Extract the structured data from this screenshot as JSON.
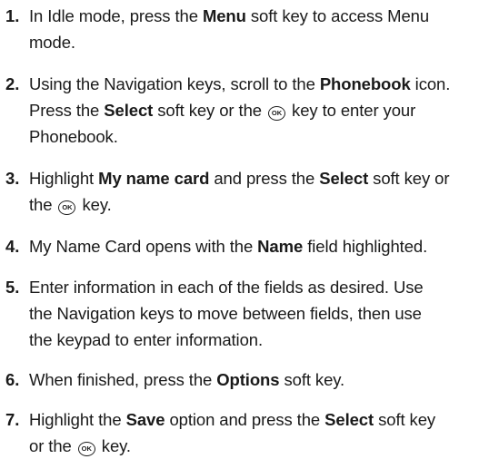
{
  "document": {
    "steps": [
      {
        "number": "1.",
        "parts": [
          {
            "t": "text",
            "v": "In Idle mode, press the "
          },
          {
            "t": "bold",
            "v": "Menu"
          },
          {
            "t": "text",
            "v": " soft key to access Menu"
          },
          {
            "t": "br"
          },
          {
            "t": "text",
            "v": "mode."
          }
        ]
      },
      {
        "number": "2.",
        "parts": [
          {
            "t": "text",
            "v": "Using the Navigation keys, scroll to the "
          },
          {
            "t": "bold",
            "v": "Phonebook"
          },
          {
            "t": "text",
            "v": " icon."
          },
          {
            "t": "br"
          },
          {
            "t": "text",
            "v": "Press the "
          },
          {
            "t": "bold",
            "v": "Select"
          },
          {
            "t": "text",
            "v": " soft key or the "
          },
          {
            "t": "icon",
            "v": "OK"
          },
          {
            "t": "text",
            "v": " key to enter your"
          },
          {
            "t": "br"
          },
          {
            "t": "text",
            "v": "Phonebook."
          }
        ]
      },
      {
        "number": "3.",
        "parts": [
          {
            "t": "text",
            "v": "Highlight "
          },
          {
            "t": "bold",
            "v": "My name card"
          },
          {
            "t": "text",
            "v": " and press the "
          },
          {
            "t": "bold",
            "v": "Select"
          },
          {
            "t": "text",
            "v": " soft key or"
          },
          {
            "t": "br"
          },
          {
            "t": "text",
            "v": "the "
          },
          {
            "t": "icon",
            "v": "OK"
          },
          {
            "t": "text",
            "v": " key."
          }
        ]
      },
      {
        "number": "4.",
        "parts": [
          {
            "t": "text",
            "v": "My Name Card opens with the "
          },
          {
            "t": "bold",
            "v": "Name"
          },
          {
            "t": "text",
            "v": " field highlighted."
          }
        ]
      },
      {
        "number": "5.",
        "parts": [
          {
            "t": "text",
            "v": "Enter information in each of the fields as desired. Use"
          },
          {
            "t": "br"
          },
          {
            "t": "text",
            "v": "the Navigation keys to move between fields, then use"
          },
          {
            "t": "br"
          },
          {
            "t": "text",
            "v": "the keypad to enter information."
          }
        ]
      },
      {
        "number": "6.",
        "parts": [
          {
            "t": "text",
            "v": "When finished, press the "
          },
          {
            "t": "bold",
            "v": "Options"
          },
          {
            "t": "text",
            "v": " soft key."
          }
        ]
      },
      {
        "number": "7.",
        "parts": [
          {
            "t": "text",
            "v": "Highlight the "
          },
          {
            "t": "bold",
            "v": "Save"
          },
          {
            "t": "text",
            "v": " option and press the "
          },
          {
            "t": "bold",
            "v": "Select"
          },
          {
            "t": "text",
            "v": " soft key"
          },
          {
            "t": "br"
          },
          {
            "t": "text",
            "v": "or the "
          },
          {
            "t": "icon",
            "v": "OK"
          },
          {
            "t": "text",
            "v": " key."
          }
        ]
      }
    ]
  }
}
